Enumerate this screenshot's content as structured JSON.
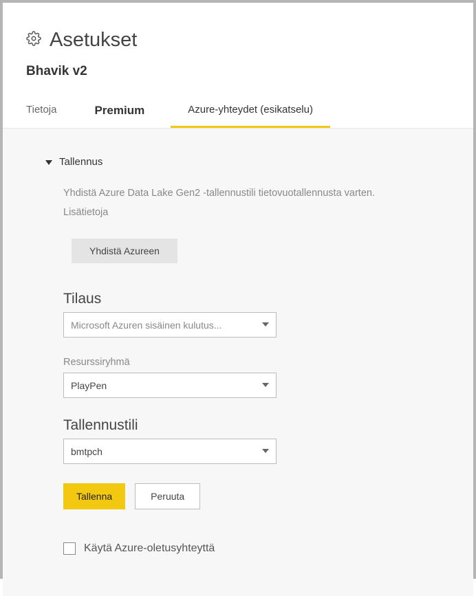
{
  "header": {
    "title": "Asetukset",
    "subtitle": "Bhavik v2"
  },
  "tabs": {
    "info": "Tietoja",
    "premium": "Premium",
    "azure": "Azure-yhteydet (esikatselu)"
  },
  "storage": {
    "section_title": "Tallennus",
    "description": "Yhdistä Azure Data Lake Gen2 -tallennustili tietovuotallennusta varten. Lisätietoja",
    "connect_button": "Yhdistä Azureen",
    "subscription_label": "Tilaus",
    "subscription_value": "Microsoft Azuren sisäinen kulutus...",
    "resource_group_label": "Resurssiryhmä",
    "resource_group_value": "PlayPen",
    "storage_account_label": "Tallennustili",
    "storage_account_value": "bmtpch",
    "save_button": "Tallenna",
    "cancel_button": "Peruuta",
    "use_default_checkbox": "Käytä Azure-oletusyhteyttä"
  }
}
